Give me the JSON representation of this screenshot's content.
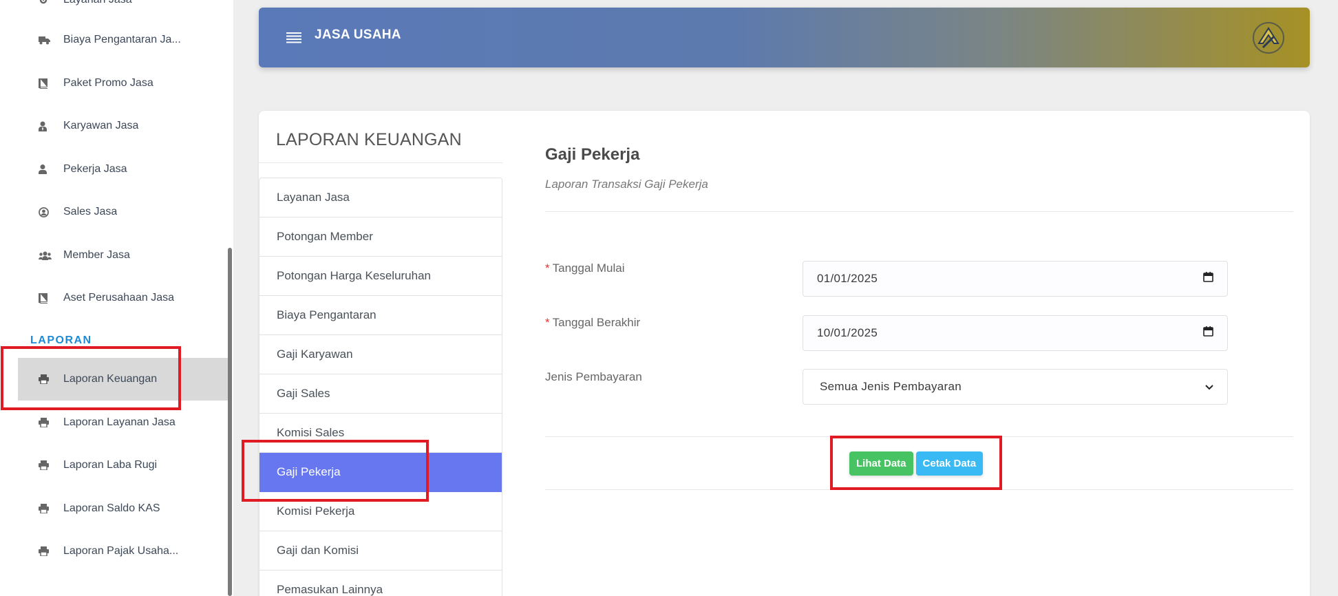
{
  "sidebar": {
    "items": [
      {
        "label": "Layanan Jasa",
        "icon": "gear-icon"
      },
      {
        "label": "Biaya Pengantaran Ja...",
        "icon": "truck-icon"
      },
      {
        "label": "Paket Promo Jasa",
        "icon": "book-icon"
      },
      {
        "label": "Karyawan Jasa",
        "icon": "user-tie-icon"
      },
      {
        "label": "Pekerja Jasa",
        "icon": "user-icon"
      },
      {
        "label": "Sales Jasa",
        "icon": "user-circle-icon"
      },
      {
        "label": "Member Jasa",
        "icon": "users-icon"
      },
      {
        "label": "Aset Perusahaan Jasa",
        "icon": "book-icon"
      }
    ],
    "section_label": "LAPORAN",
    "report_items": [
      {
        "label": "Laporan Keuangan",
        "icon": "printer-icon",
        "active": true
      },
      {
        "label": "Laporan Layanan Jasa",
        "icon": "printer-icon"
      },
      {
        "label": "Laporan Laba Rugi",
        "icon": "printer-icon"
      },
      {
        "label": "Laporan Saldo KAS",
        "icon": "printer-icon"
      },
      {
        "label": "Laporan Pajak Usaha...",
        "icon": "printer-icon"
      }
    ]
  },
  "header": {
    "title": "JASA USAHA",
    "menu_icon": "hamburger-icon",
    "logo_icon": "brand-logo-icon"
  },
  "report_menu": {
    "heading": "LAPORAN KEUANGAN",
    "items": [
      "Layanan Jasa",
      "Potongan Member",
      "Potongan Harga Keseluruhan",
      "Biaya Pengantaran",
      "Gaji Karyawan",
      "Gaji Sales",
      "Komisi Sales",
      "Gaji Pekerja",
      "Komisi Pekerja",
      "Gaji dan Komisi",
      "Pemasukan Lainnya"
    ],
    "active_index": 7
  },
  "form": {
    "title": "Gaji Pekerja",
    "subtitle": "Laporan Transaksi Gaji Pekerja",
    "required_mark": "*",
    "start_date_label": "Tanggal Mulai",
    "start_date_value": "01/01/2025",
    "end_date_label": "Tanggal Berakhir",
    "end_date_value": "10/01/2025",
    "payment_type_label": "Jenis Pembayaran",
    "payment_type_value": "Semua Jenis Pembayaran",
    "view_button": "Lihat Data",
    "print_button": "Cetak Data"
  },
  "colors": {
    "accent": "#6777ef",
    "section": "#1e8ad6",
    "success": "#47c363",
    "info": "#3abaf4",
    "highlight": "#e01b24"
  }
}
